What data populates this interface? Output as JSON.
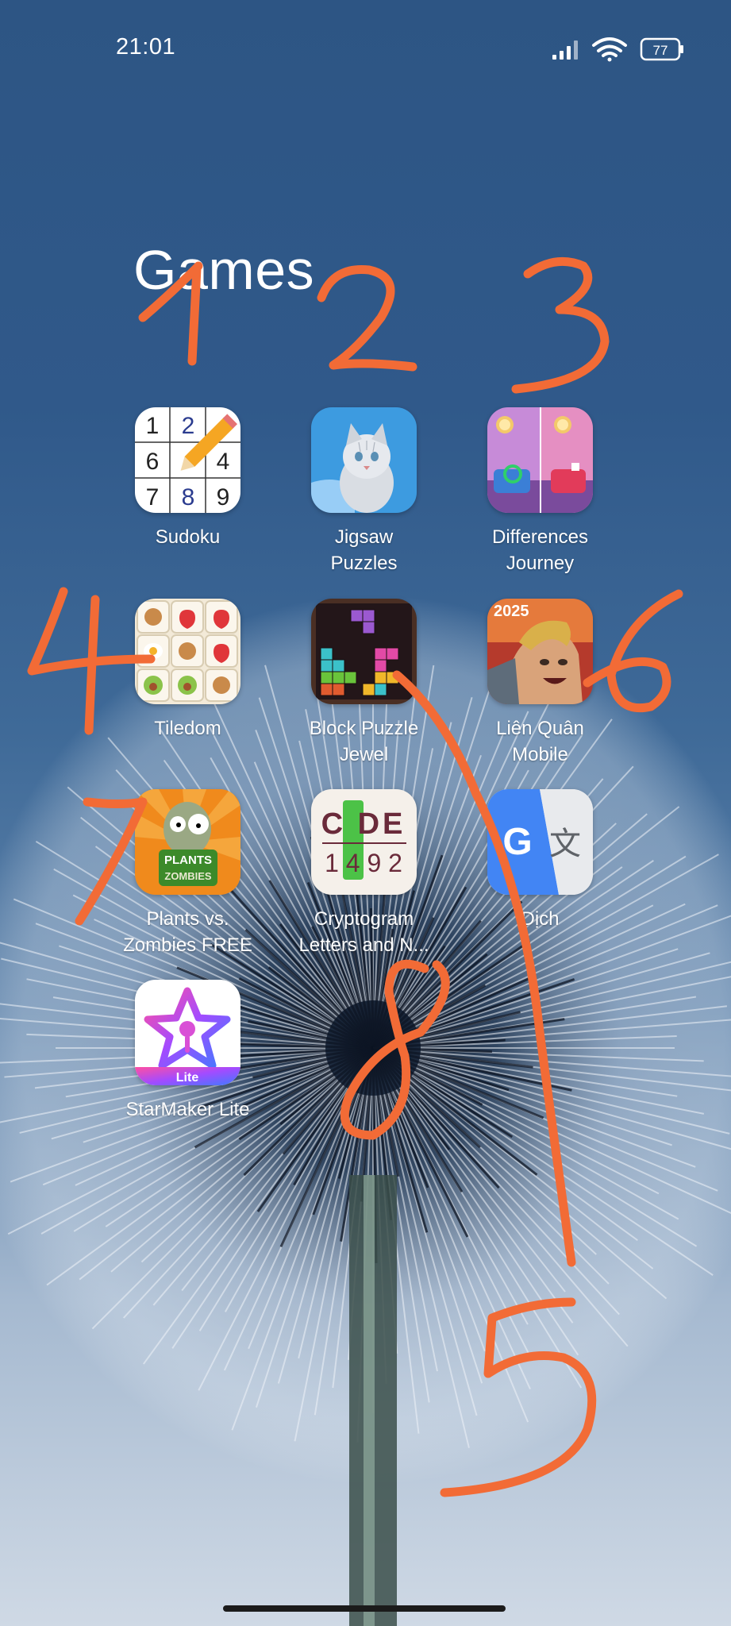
{
  "status": {
    "time": "21:01",
    "battery": "77"
  },
  "folder": {
    "title": "Games"
  },
  "apps": [
    {
      "label": "Sudoku",
      "icon": "sudoku-icon"
    },
    {
      "label": "Jigsaw\nPuzzles",
      "icon": "jigsaw-cat-icon"
    },
    {
      "label": "Differences\nJourney",
      "icon": "differences-room-icon"
    },
    {
      "label": "Tiledom",
      "icon": "tiledom-tiles-icon"
    },
    {
      "label": "Block Puzzle\nJewel",
      "icon": "jewel-blocks-icon"
    },
    {
      "label": "Liên Quân\nMobile",
      "icon": "lien-quan-hero-icon"
    },
    {
      "label": "Plants vs.\nZombies FREE",
      "icon": "zombie-icon"
    },
    {
      "label": "Cryptogram\nLetters and N...",
      "icon": "cryptogram-code-icon"
    },
    {
      "label": "Dịch",
      "icon": "translate-icon"
    },
    {
      "label": "StarMaker Lite",
      "icon": "starmaker-star-icon"
    }
  ],
  "icon_text": {
    "sudoku_digits": [
      "1",
      "2",
      "6",
      "4",
      "7",
      "8",
      "9"
    ],
    "code_top": "C DE",
    "code_bottom": "1 4 9 2",
    "pvz_top": "PLANTS",
    "pvz_bottom": "ZOMBIES",
    "lq_year": "2025",
    "translate_g": "G",
    "translate_char": "文",
    "starmaker_badge": "Lite"
  },
  "annotations": [
    "1",
    "2",
    "3",
    "4",
    "5",
    "6",
    "7",
    "8"
  ],
  "colors": {
    "annotation": "#f26b36",
    "wallpaper_top": "#2d5584"
  }
}
